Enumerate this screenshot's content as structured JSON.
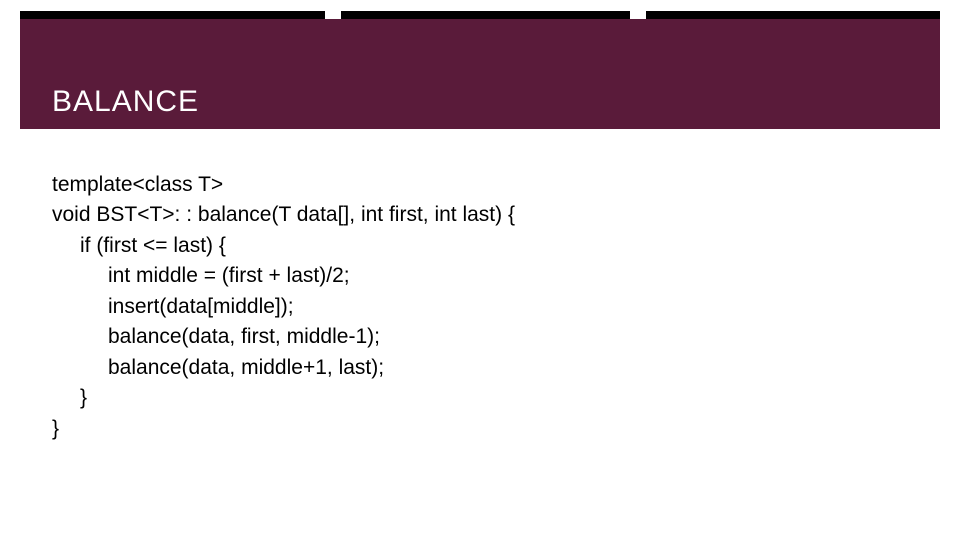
{
  "title": "BALANCE",
  "code": {
    "l0": "template<class T>",
    "l1": "void BST<T>: : balance(T data[], int first, int last) {",
    "l2": "if (first <= last) {",
    "l3": "int middle = (first + last)/2;",
    "l4": "insert(data[middle]);",
    "l5": "balance(data, first, middle-1);",
    "l6": "balance(data, middle+1, last);",
    "l7": "}",
    "l8": "}"
  },
  "colors": {
    "title_bar": "#5a1b3a",
    "accent": "#000000",
    "text": "#000000",
    "title_text": "#ffffff"
  }
}
